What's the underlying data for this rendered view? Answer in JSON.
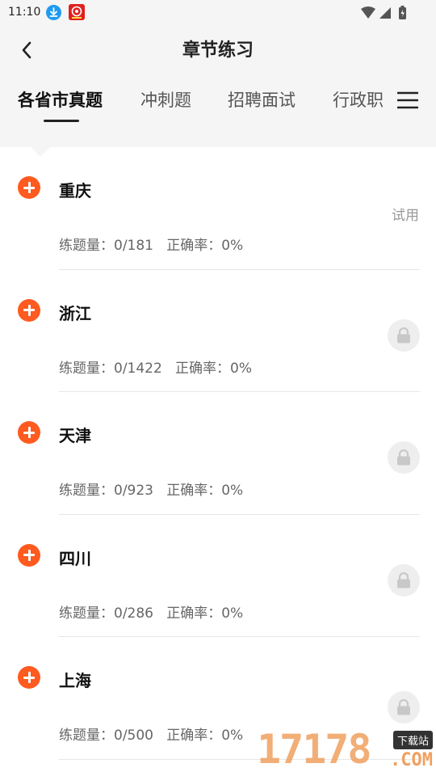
{
  "status_bar": {
    "time": "11:10"
  },
  "header": {
    "title": "章节练习"
  },
  "tabs": [
    {
      "label": "各省市真题",
      "active": true
    },
    {
      "label": "冲刺题",
      "active": false
    },
    {
      "label": "招聘面试",
      "active": false
    },
    {
      "label": "行政职",
      "active": false
    }
  ],
  "items": [
    {
      "name": "重庆",
      "stats": "练题量：0/181   正确率：0%",
      "badge": "试用",
      "locked": false
    },
    {
      "name": "浙江",
      "stats": "练题量：0/1422   正确率：0%",
      "badge": "",
      "locked": true
    },
    {
      "name": "天津",
      "stats": "练题量：0/923   正确率：0%",
      "badge": "",
      "locked": true
    },
    {
      "name": "四川",
      "stats": "练题量：0/286   正确率：0%",
      "badge": "",
      "locked": true
    },
    {
      "name": "上海",
      "stats": "练题量：0/500   正确率：0%",
      "badge": "",
      "locked": true
    }
  ],
  "watermark": {
    "number": "17178",
    "tag": "下载站",
    "suffix": ".COM"
  },
  "colors": {
    "accent": "#ff5a1f",
    "header_bg": "#f5f5f5",
    "lock_bg": "#eeeeee"
  }
}
